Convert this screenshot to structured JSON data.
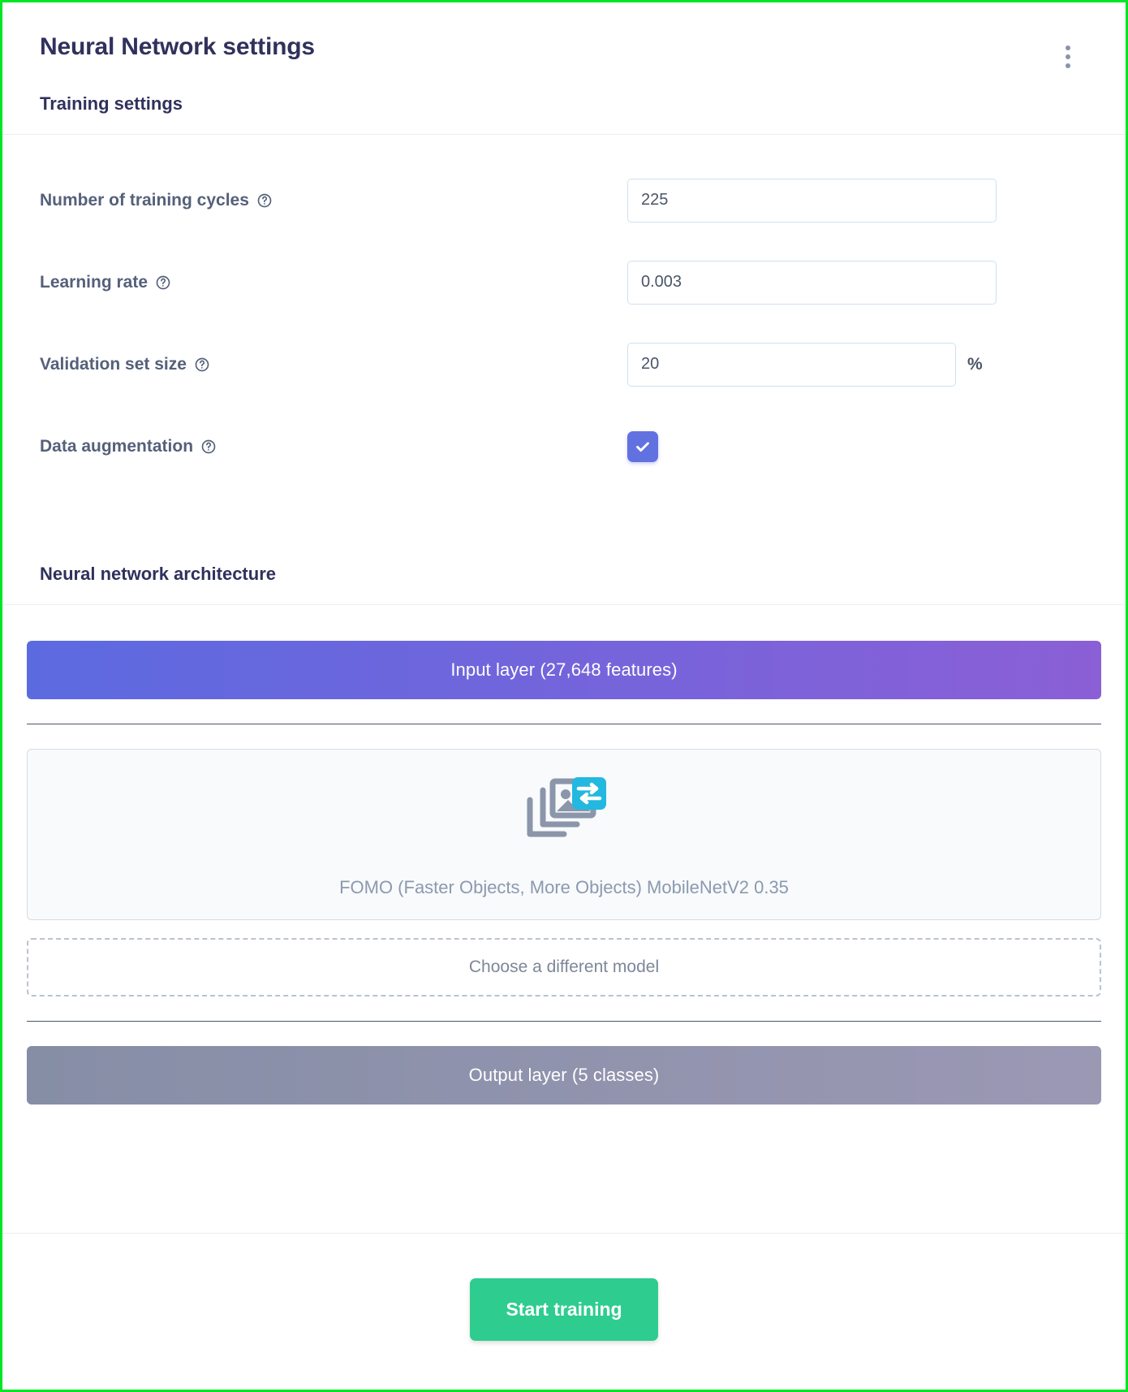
{
  "header": {
    "title": "Neural Network settings",
    "menu_icon": "kebab-menu-icon"
  },
  "training_settings": {
    "section_title": "Training settings",
    "rows": [
      {
        "label": "Number of training cycles",
        "help_icon": "help-circle-icon",
        "value": "225"
      },
      {
        "label": "Learning rate",
        "help_icon": "help-circle-icon",
        "value": "0.003"
      },
      {
        "label": "Validation set size",
        "help_icon": "help-circle-icon",
        "value": "20",
        "suffix": "%"
      },
      {
        "label": "Data augmentation",
        "help_icon": "help-circle-icon",
        "checked": true
      }
    ]
  },
  "architecture": {
    "section_title": "Neural network architecture",
    "input_layer": "Input layer (27,648 features)",
    "model": {
      "icon": "image-transfer-icon",
      "name": "FOMO (Faster Objects, More Objects) MobileNetV2 0.35"
    },
    "choose_different_model": "Choose a different model",
    "output_layer": "Output layer (5 classes)"
  },
  "footer": {
    "start_training": "Start training"
  },
  "colors": {
    "window_border": "#00e626",
    "title": "#30315c",
    "label": "#55607a",
    "input_border": "#cfe0f0",
    "checkbox": "#6271e0",
    "input_layer_from": "#5c6ae0",
    "input_layer_to": "#8b5fd6",
    "output_layer_from": "#868ea6",
    "output_layer_to": "#9b98b4",
    "accent_green": "#2ecc8f",
    "icon_cyan": "#22b8e0",
    "icon_gray": "#8b96aa"
  }
}
